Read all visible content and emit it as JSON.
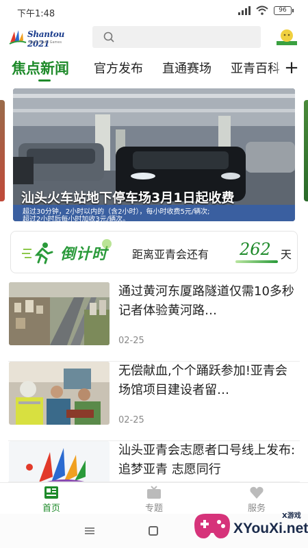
{
  "status_bar": {
    "time": "下午1:48",
    "battery": "96"
  },
  "header": {
    "logo_text": "Shantou 2021",
    "logo_subtext": "Asian Youth Games",
    "search_icon": "search-icon",
    "user_icon": "user-avatar-icon"
  },
  "tabs": {
    "items": [
      {
        "label": "焦点新闻",
        "active": true
      },
      {
        "label": "官方发布",
        "active": false
      },
      {
        "label": "直通赛场",
        "active": false
      },
      {
        "label": "亚青百科",
        "active": false
      }
    ],
    "add_icon": "plus-icon",
    "accent_color": "#1e8a2a"
  },
  "banner": {
    "title": "汕头火车站地下停车场3月1日起收费",
    "caption_line1": "超过30分钟，2小时以内的（含2小时），每小时收费5元/辆次;",
    "caption_line2": "超过2小时后每小时加收3元/辆次。"
  },
  "countdown": {
    "title": "倒计时",
    "label": "距离亚青会还有",
    "days": "262",
    "unit": "天",
    "icon": "runner-icon"
  },
  "news": [
    {
      "title": "通过黄河东厦路隧道仅需10多秒  记者体验黄河路…",
      "date": "02-25",
      "thumb": "city-aerial-image"
    },
    {
      "title": "无偿献血,个个踊跃参加!亚青会场馆项目建设者留…",
      "date": "02-25",
      "thumb": "blood-donation-image"
    },
    {
      "title": "汕头亚青会志愿者口号线上发布:追梦亚青 志愿同行",
      "date": "",
      "thumb": "volunteer-logo-image"
    }
  ],
  "bottom_nav": {
    "items": [
      {
        "label": "首页",
        "icon": "home-news-icon",
        "active": true
      },
      {
        "label": "专题",
        "icon": "topics-tv-icon",
        "active": false
      },
      {
        "label": "服务",
        "icon": "service-heart-icon",
        "active": false
      }
    ]
  },
  "watermark": {
    "text": "XYouXi.net",
    "small": "X游戏"
  }
}
